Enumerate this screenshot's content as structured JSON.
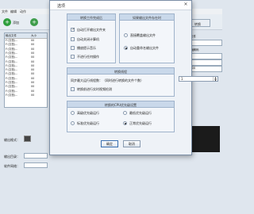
{
  "app": {
    "menu": [
      "文件",
      "编辑",
      "动作"
    ],
    "toolbar": {
      "add_label": "添加",
      "right_label": "转换"
    },
    "file_list": {
      "headers": [
        "输出文件",
        "大小"
      ],
      "rows": [
        [
          "F:\\文档\\...",
          "00"
        ],
        [
          "F:\\文档\\...",
          "00"
        ],
        [
          "F:\\文档\\...",
          "00"
        ],
        [
          "F:\\文档\\...",
          "00"
        ],
        [
          "F:\\文档\\...",
          "00"
        ],
        [
          "F:\\文档\\...",
          "00"
        ],
        [
          "F:\\文档\\...",
          "00"
        ],
        [
          "F:\\文档\\...",
          "00"
        ],
        [
          "F:\\文档\\...",
          "00"
        ],
        [
          "F:\\文档\\...",
          "00"
        ],
        [
          "F:\\文档\\...",
          "00"
        ],
        [
          "F:\\文档\\...",
          "00"
        ],
        [
          "F:\\文档\\...",
          "00"
        ],
        [
          "F:\\文档\\...",
          "00"
        ]
      ]
    },
    "left_labels": {
      "output_format": "输出格式：",
      "output_dir": "输出目录：",
      "software": "软件网络："
    },
    "right_panel": {
      "label1": "输出文件",
      "field1": "",
      "label2": "视频编解码",
      "field2": "",
      "field3": "30",
      "field4": "32000"
    }
  },
  "dialog": {
    "title": "选项",
    "close_glyph": "✕",
    "group_after_convert": {
      "title": "转换工作完成后",
      "options": [
        {
          "label": "自动打开输出文件夹",
          "checked": true
        },
        {
          "label": "自动关闭计算机",
          "checked": false
        },
        {
          "label": "播放提示音乐",
          "checked": false
        },
        {
          "label": "不进行任何操作",
          "checked": false
        }
      ]
    },
    "group_output_name": {
      "title": "如果输出文件存在时",
      "options": [
        {
          "label": "直接覆盖输出文件",
          "selected": false
        },
        {
          "label": "自动重命名输出文件",
          "selected": true
        }
      ]
    },
    "group_threads": {
      "title": "转换线程",
      "max_threads_label": "同步最大运行线程数：（同时进行转换的文件个数）",
      "max_threads_value": "1",
      "spin_up": "▲",
      "spin_down": "▼",
      "auto_adjust_label": "转换前进行实时视频检测",
      "auto_adjust_checked": false
    },
    "group_priority": {
      "title": "转换的CPU优先级设置",
      "options": [
        {
          "label": "高级优先级运行",
          "selected": false
        },
        {
          "label": "最低优先级运行",
          "selected": false
        },
        {
          "label": "标准优先级运行",
          "selected": false
        },
        {
          "label": "正常优先级运行",
          "selected": true
        }
      ]
    },
    "ok_label": "确定",
    "cancel_label": "取消"
  }
}
